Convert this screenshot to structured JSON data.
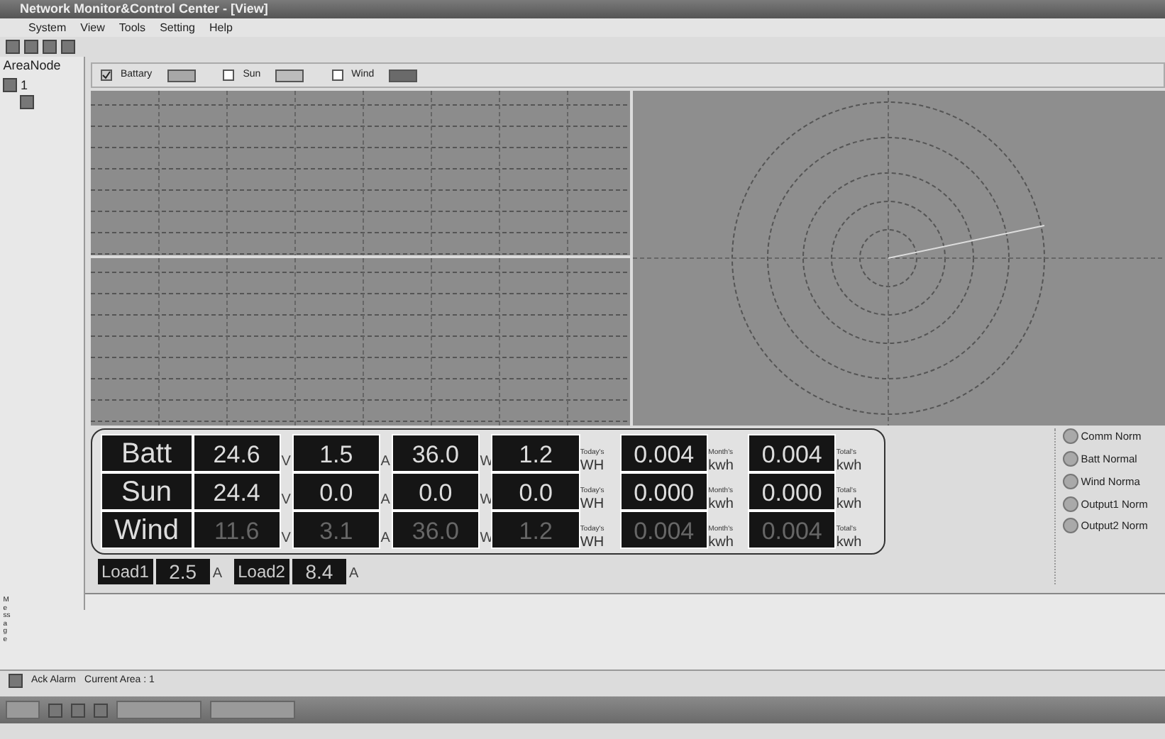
{
  "window": {
    "title": "Network Monitor&Control Center - [View]"
  },
  "menu": [
    "System",
    "View",
    "Tools",
    "Setting",
    "Help"
  ],
  "tree": {
    "header": "AreaNode",
    "items": [
      {
        "label": "1",
        "expanded": true
      }
    ]
  },
  "legend": [
    {
      "label": "Battary",
      "checked": true,
      "color": "#a8a8a8"
    },
    {
      "label": "Sun",
      "checked": false,
      "color": "#bcbcbc"
    },
    {
      "label": "Wind",
      "checked": false,
      "color": "#6a6a6a"
    }
  ],
  "readings": [
    {
      "name": "Batt",
      "dimmed": false,
      "cells": [
        {
          "value": "24.6",
          "unit": "V"
        },
        {
          "value": "1.5",
          "unit": "A"
        },
        {
          "value": "36.0",
          "unit": "W"
        },
        {
          "value": "1.2",
          "caption": "Today's",
          "unit": "WH"
        },
        {
          "value": "0.004",
          "caption": "Month's",
          "unit": "kwh"
        },
        {
          "value": "0.004",
          "caption": "Total's",
          "unit": "kwh"
        }
      ]
    },
    {
      "name": "Sun",
      "dimmed": false,
      "cells": [
        {
          "value": "24.4",
          "unit": "V"
        },
        {
          "value": "0.0",
          "unit": "A"
        },
        {
          "value": "0.0",
          "unit": "W"
        },
        {
          "value": "0.0",
          "caption": "Today's",
          "unit": "WH"
        },
        {
          "value": "0.000",
          "caption": "Month's",
          "unit": "kwh"
        },
        {
          "value": "0.000",
          "caption": "Total's",
          "unit": "kwh"
        }
      ]
    },
    {
      "name": "Wind",
      "dimmed": true,
      "cells": [
        {
          "value": "11.6",
          "unit": "V"
        },
        {
          "value": "3.1",
          "unit": "A"
        },
        {
          "value": "36.0",
          "unit": "W"
        },
        {
          "value": "1.2",
          "caption": "Today's",
          "unit": "WH"
        },
        {
          "value": "0.004",
          "caption": "Month's",
          "unit": "kwh"
        },
        {
          "value": "0.004",
          "caption": "Total's",
          "unit": "kwh"
        }
      ]
    }
  ],
  "loads": [
    {
      "name": "Load1",
      "value": "2.5",
      "unit": "A"
    },
    {
      "name": "Load2",
      "value": "8.4",
      "unit": "A"
    }
  ],
  "status_lights": [
    "Comm Norm",
    "Batt Normal",
    "Wind Norma",
    "Output1 Norm",
    "Output2 Norm"
  ],
  "message_panel": {
    "label": "Message"
  },
  "status_bar": [
    "Ack Alarm",
    "Current Area : 1"
  ]
}
